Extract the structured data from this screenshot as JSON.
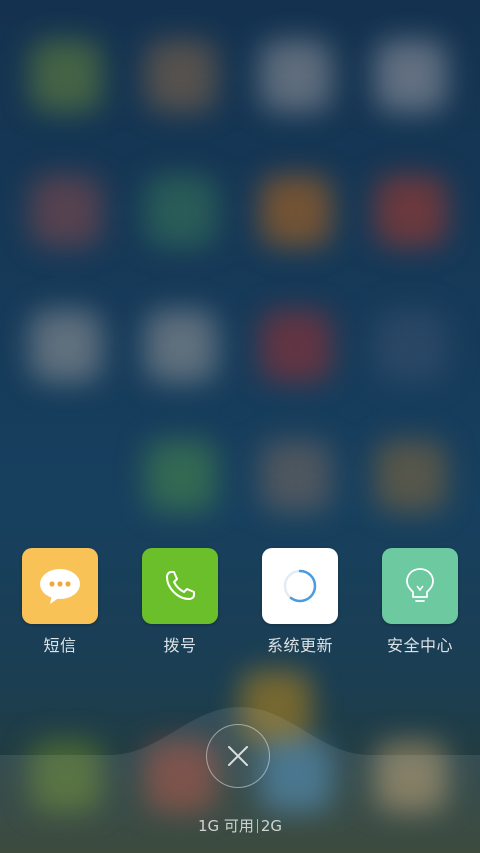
{
  "recent_apps": [
    {
      "label": "短信",
      "icon": "message-icon",
      "color": "#f9c256"
    },
    {
      "label": "拨号",
      "icon": "phone-icon",
      "color": "#6bbf2b"
    },
    {
      "label": "系统更新",
      "icon": "update-icon",
      "color": "#ffffff"
    },
    {
      "label": "安全中心",
      "icon": "security-center-icon",
      "color": "#6cc9a0"
    }
  ],
  "memory": {
    "available": "1G 可用",
    "total": "2G"
  },
  "close_icon": "close-icon"
}
